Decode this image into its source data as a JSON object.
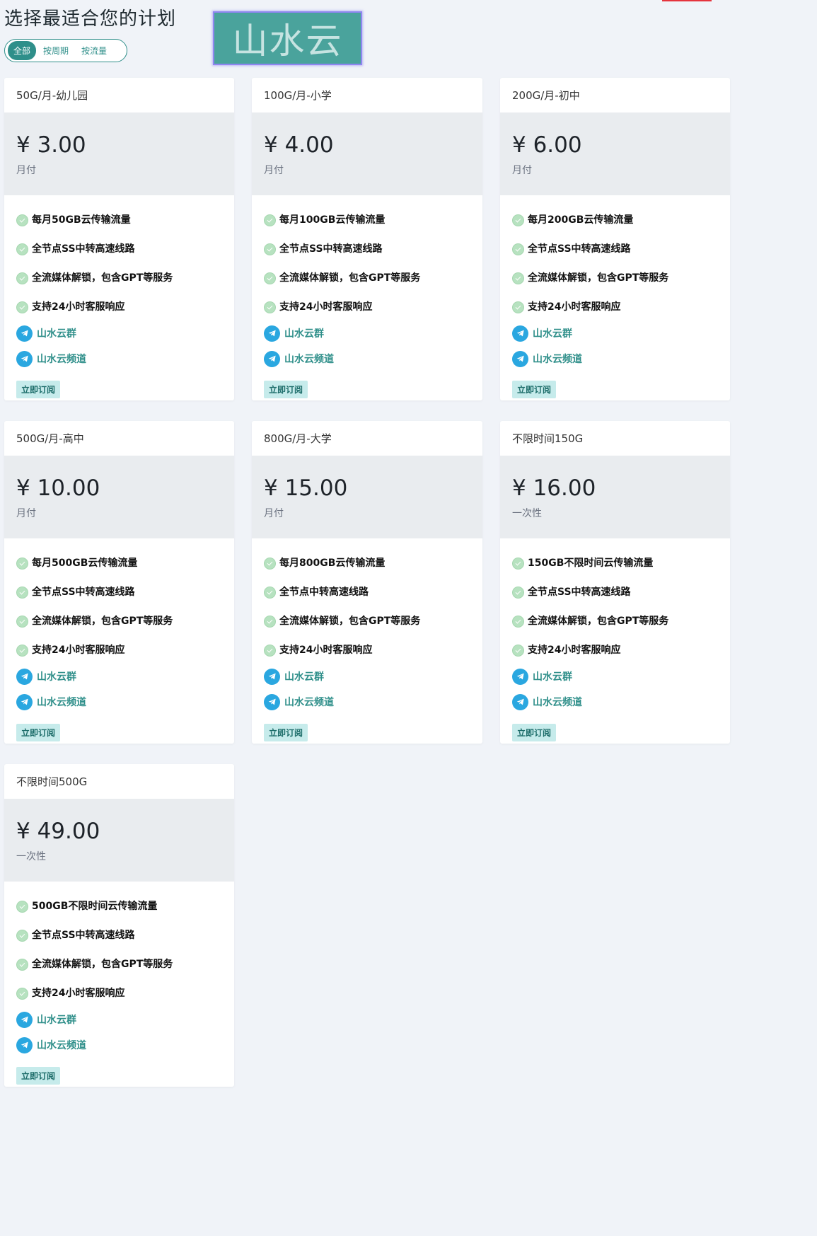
{
  "page_title": "选择最适合您的计划",
  "logo_text": "山水云",
  "filter_tabs": [
    "全部",
    "按周期",
    "按流量"
  ],
  "currency_symbol": "¥",
  "plans": [
    {
      "name": "50G/月-幼儿园",
      "price": "¥ 3.00",
      "period": "月付",
      "features": [
        "每月50GB云传输流量",
        "全节点SS中转高速线路",
        "全流媒体解锁，包含GPT等服务",
        "支持24小时客服响应"
      ],
      "links": [
        "山水云群",
        "山水云频道"
      ],
      "button": "立即订阅"
    },
    {
      "name": "100G/月-小学",
      "price": "¥ 4.00",
      "period": "月付",
      "features": [
        "每月100GB云传输流量",
        "全节点SS中转高速线路",
        "全流媒体解锁，包含GPT等服务",
        "支持24小时客服响应"
      ],
      "links": [
        "山水云群",
        "山水云频道"
      ],
      "button": "立即订阅"
    },
    {
      "name": "200G/月-初中",
      "price": "¥ 6.00",
      "period": "月付",
      "features": [
        "每月200GB云传输流量",
        "全节点SS中转高速线路",
        "全流媒体解锁，包含GPT等服务",
        "支持24小时客服响应"
      ],
      "links": [
        "山水云群",
        "山水云频道"
      ],
      "button": "立即订阅"
    },
    {
      "name": "500G/月-高中",
      "price": "¥ 10.00",
      "period": "月付",
      "features": [
        "每月500GB云传输流量",
        "全节点SS中转高速线路",
        "全流媒体解锁，包含GPT等服务",
        "支持24小时客服响应"
      ],
      "links": [
        "山水云群",
        "山水云频道"
      ],
      "button": "立即订阅"
    },
    {
      "name": "800G/月-大学",
      "price": "¥ 15.00",
      "period": "月付",
      "features": [
        "每月800GB云传输流量",
        "全节点中转高速线路",
        "全流媒体解锁，包含GPT等服务",
        "支持24小时客服响应"
      ],
      "links": [
        "山水云群",
        "山水云频道"
      ],
      "button": "立即订阅"
    },
    {
      "name": "不限时间150G",
      "price": "¥ 16.00",
      "period": "一次性",
      "features": [
        "150GB不限时间云传输流量",
        "全节点SS中转高速线路",
        "全流媒体解锁，包含GPT等服务",
        "支持24小时客服响应"
      ],
      "links": [
        "山水云群",
        "山水云频道"
      ],
      "button": "立即订阅"
    },
    {
      "name": "不限时间500G",
      "price": "¥ 49.00",
      "period": "一次性",
      "features": [
        "500GB不限时间云传输流量",
        "全节点SS中转高速线路",
        "全流媒体解锁，包含GPT等服务",
        "支持24小时客服响应"
      ],
      "links": [
        "山水云群",
        "山水云频道"
      ],
      "button": "立即订阅"
    }
  ],
  "colors": {
    "accent": "#2f8f8a",
    "background": "#f0f3f8",
    "price_band": "#e9ecef",
    "telegram": "#2aa7e0",
    "check": "#b7e2c0",
    "button_bg": "#c6ebeb",
    "logo_bg": "#4aa39c"
  }
}
